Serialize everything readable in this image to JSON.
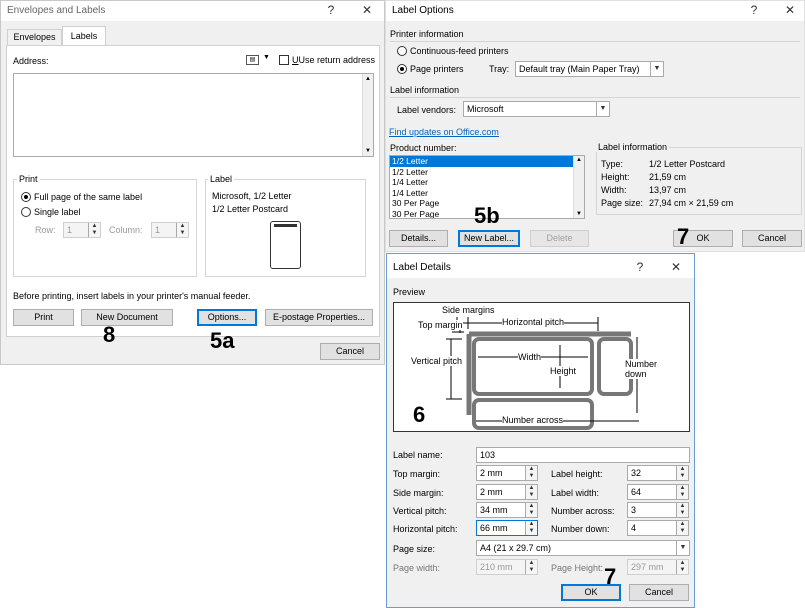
{
  "env": {
    "title": "Envelopes and Labels",
    "help": "?",
    "close": "✕",
    "tabs": [
      "Envelopes",
      "Labels"
    ],
    "address_label": "Address:",
    "use_return_label": "Use return address",
    "print_group": "Print",
    "full_page": "Full page of the same label",
    "single_label": "Single label",
    "row_label": "Row:",
    "row_value": "1",
    "column_label": "Column:",
    "column_value": "1",
    "label_group": "Label",
    "label_line1": "Microsoft, 1/2 Letter",
    "label_line2": "1/2 Letter Postcard",
    "feeder_note": "Before printing, insert labels in your printer's manual feeder.",
    "print_btn": "Print",
    "new_doc_btn": "New Document",
    "options_btn": "Options...",
    "epostage_btn": "E-postage Properties...",
    "cancel_btn": "Cancel"
  },
  "opts": {
    "title": "Label Options",
    "help": "?",
    "close": "✕",
    "printer_info": "Printer information",
    "continuous": "Continuous-feed printers",
    "page_printers": "Page printers",
    "tray_label": "Tray:",
    "tray_value": "Default tray (Main Paper Tray)",
    "label_info": "Label information",
    "vendors_label": "Label vendors:",
    "vendors_value": "Microsoft",
    "find_updates": "Find updates on Office.com",
    "product_number": "Product number:",
    "products": [
      "1/2 Letter",
      "1/2 Letter",
      "1/4 Letter",
      "1/4 Letter",
      "30 Per Page",
      "30 Per Page"
    ],
    "info_title": "Label information",
    "info_rows": [
      {
        "k": "Type:",
        "v": "1/2 Letter Postcard"
      },
      {
        "k": "Height:",
        "v": "21,59 cm"
      },
      {
        "k": "Width:",
        "v": "13,97 cm"
      },
      {
        "k": "Page size:",
        "v": "27,94 cm × 21,59 cm"
      }
    ],
    "details_btn": "Details...",
    "new_label_btn": "New Label...",
    "delete_btn": "Delete",
    "ok_btn": "OK",
    "cancel_btn": "Cancel"
  },
  "details": {
    "title": "Label Details",
    "help": "?",
    "close": "✕",
    "preview": "Preview",
    "diag_side_margins": "Side margins",
    "diag_top_margin": "Top margin",
    "diag_horizontal_pitch": "Horizontal pitch",
    "diag_vertical_pitch": "Vertical pitch",
    "diag_width": "Width",
    "diag_height": "Height",
    "diag_number_down": "Number down",
    "diag_number_across": "Number across",
    "label_name": "Label name:",
    "label_name_value": "103",
    "top_margin": "Top margin:",
    "top_margin_value": "2 mm",
    "side_margin": "Side margin:",
    "side_margin_value": "2 mm",
    "vertical_pitch": "Vertical pitch:",
    "vertical_pitch_value": "34 mm",
    "horizontal_pitch": "Horizontal pitch:",
    "horizontal_pitch_value": "66 mm",
    "label_height": "Label height:",
    "label_height_value": "32",
    "label_width": "Label width:",
    "label_width_value": "64",
    "number_across": "Number across:",
    "number_across_value": "3",
    "number_down": "Number down:",
    "number_down_value": "4",
    "page_size": "Page size:",
    "page_size_value": "A4 (21 x 29.7 cm)",
    "page_width": "Page width:",
    "page_width_value": "210 mm",
    "page_height": "Page Height:",
    "page_height_value": "297 mm",
    "ok_btn": "OK",
    "cancel_btn": "Cancel"
  },
  "steps": {
    "s8": "8",
    "s5a": "5a",
    "s5b": "5b",
    "s7a": "7",
    "s6": "6",
    "s7b": "7"
  },
  "colors": {
    "accent": "#0078d7",
    "dialog_bg": "#f0f0f0",
    "link": "#0563c1"
  }
}
